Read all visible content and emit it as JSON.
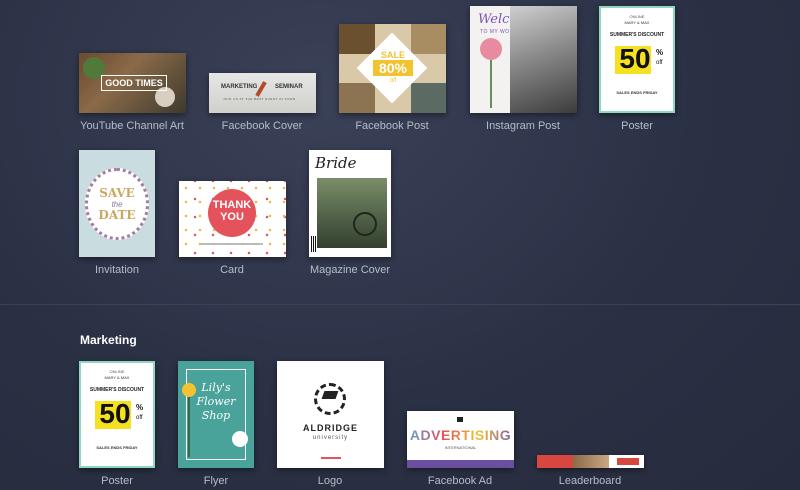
{
  "templates_row1": [
    {
      "label": "YouTube Channel Art",
      "text": "GOOD TIMES"
    },
    {
      "label": "Facebook Cover",
      "text_left": "MARKETING",
      "text_right": "SEMINAR",
      "sub": "JOIN US AT THE BEST EVENT IN TOWN"
    },
    {
      "label": "Facebook Post",
      "sale": "SALE",
      "pct": "80%",
      "off": "off"
    },
    {
      "label": "Instagram Post",
      "welcome": "Welcome",
      "sub": "TO MY WORLD"
    },
    {
      "label": "Poster",
      "top": "ONLINE",
      "brand": "MARY & MAX",
      "headline": "SUMMER'S DISCOUNT",
      "big": "50",
      "pct": "%",
      "off": "off",
      "footer": "SALES ENDS FRIDAY"
    }
  ],
  "templates_row2": [
    {
      "label": "Invitation",
      "l1": "SAVE",
      "l2": "the",
      "l3": "DATE"
    },
    {
      "label": "Card",
      "l1": "THANK",
      "l2": "YOU"
    },
    {
      "label": "Magazine Cover",
      "title": "Bride"
    }
  ],
  "marketing": {
    "title": "Marketing",
    "items": [
      {
        "label": "Poster",
        "top": "ONLINE",
        "brand": "MARY & MAX",
        "headline": "SUMMER'S DISCOUNT",
        "big": "50",
        "pct": "%",
        "off": "off",
        "footer": "SALES ENDS FRIDAY"
      },
      {
        "label": "Flyer",
        "l1": "Lily's",
        "l2": "Flower",
        "l3": "Shop"
      },
      {
        "label": "Logo",
        "name": "ALDRIDGE",
        "sub": "university"
      },
      {
        "label": "Facebook Ad",
        "word": "ADVERTISING",
        "sub": "INTERNATIONAL"
      },
      {
        "label": "Leaderboard"
      }
    ]
  },
  "colors": {
    "background": "#2b3145",
    "caption": "#b5bcc9",
    "poster_yellow": "#f5e11f",
    "poster_border": "#8fd8c0",
    "sale_yellow": "#f2c230",
    "card_red": "#e4525b"
  }
}
